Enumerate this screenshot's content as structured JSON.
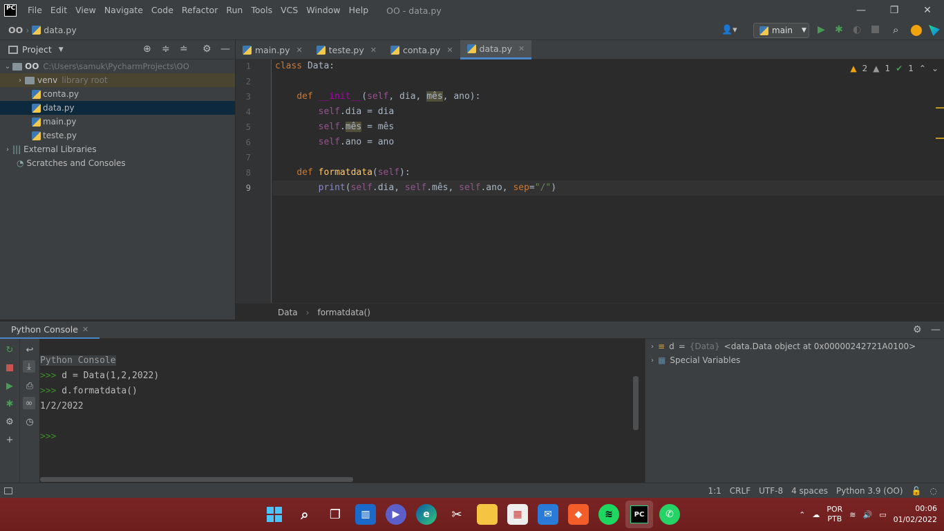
{
  "app": {
    "logo": "PC",
    "window_title": "OO - data.py"
  },
  "menu": [
    "File",
    "Edit",
    "View",
    "Navigate",
    "Code",
    "Refactor",
    "Run",
    "Tools",
    "VCS",
    "Window",
    "Help"
  ],
  "window_controls": {
    "minimize": "—",
    "restore": "❐",
    "close": "✕"
  },
  "navbar": {
    "project": "OO",
    "file": "data.py",
    "run_config": "main"
  },
  "project_panel": {
    "title": "Project",
    "root": {
      "name": "OO",
      "path": "C:\\Users\\samuk\\PycharmProjects\\OO"
    },
    "items": [
      {
        "name": "venv",
        "hint": "library root",
        "type": "folder"
      },
      {
        "name": "conta.py",
        "type": "py"
      },
      {
        "name": "data.py",
        "type": "py",
        "selected": true
      },
      {
        "name": "main.py",
        "type": "py"
      },
      {
        "name": "teste.py",
        "type": "py"
      }
    ],
    "external": "External Libraries",
    "scratches": "Scratches and Consoles"
  },
  "tabs": [
    {
      "label": "main.py"
    },
    {
      "label": "teste.py"
    },
    {
      "label": "conta.py"
    },
    {
      "label": "data.py",
      "active": true
    }
  ],
  "inspections": {
    "warnings": "2",
    "weak": "1",
    "ok": "1"
  },
  "line_numbers": [
    "1",
    "2",
    "3",
    "4",
    "5",
    "6",
    "7",
    "8",
    "9"
  ],
  "breadcrumb": {
    "cls": "Data",
    "method": "formatdata()"
  },
  "console": {
    "tab": "Python Console",
    "header": "Python Console",
    "lines": [
      {
        "prompt": ">>>",
        "text": " d = Data(1,2,2022)"
      },
      {
        "prompt": ">>>",
        "text": " d.formatdata()"
      },
      {
        "prompt": "",
        "text": "1/2/2022"
      },
      {
        "prompt": ">>>",
        "text": ""
      }
    ]
  },
  "variables": [
    {
      "name": "d",
      "type": "{Data}",
      "value": "<data.Data object at 0x00000242721A0100>"
    },
    {
      "name": "Special Variables"
    }
  ],
  "status": {
    "position": "1:1",
    "line_sep": "CRLF",
    "encoding": "UTF-8",
    "indent": "4 spaces",
    "interpreter": "Python 3.9 (OO)"
  },
  "tray": {
    "lang": "POR",
    "layout": "PTB",
    "time": "00:06",
    "date": "01/02/2022"
  }
}
